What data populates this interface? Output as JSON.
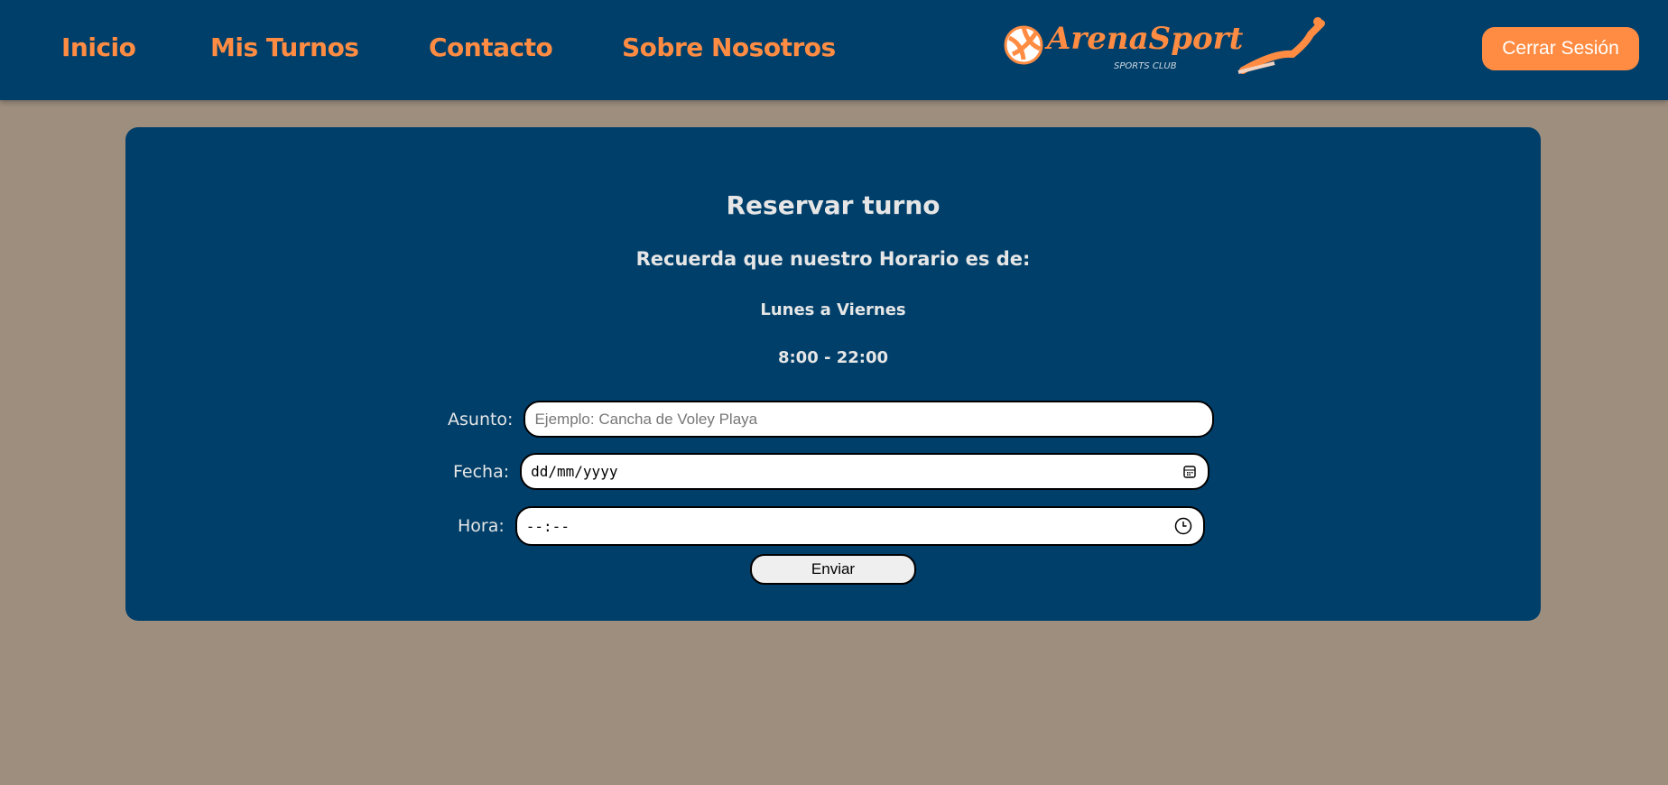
{
  "nav": {
    "items": [
      {
        "label": "Inicio"
      },
      {
        "label": "Mis Turnos"
      },
      {
        "label": "Contacto"
      },
      {
        "label": "Sobre Nosotros"
      }
    ],
    "logo": {
      "title": "ArenaSport",
      "subtitle": "SPORTS CLUB"
    },
    "logout_label": "Cerrar Sesión"
  },
  "colors": {
    "header": "#003f6a",
    "accent": "#ff8c42",
    "background": "#9d8e7e"
  },
  "form": {
    "title": "Reservar turno",
    "notice": "Recuerda que nuestro Horario es de:",
    "days": "Lunes a Viernes",
    "hours": "8:00 - 22:00",
    "subject": {
      "label": "Asunto:",
      "placeholder": "Ejemplo: Cancha de Voley Playa",
      "value": ""
    },
    "date": {
      "label": "Fecha:",
      "placeholder": "dd/mm/yyyy",
      "icon": "calendar-icon"
    },
    "time": {
      "label": "Hora:",
      "placeholder": "--:--",
      "icon": "clock-icon"
    },
    "submit_label": "Enviar"
  }
}
